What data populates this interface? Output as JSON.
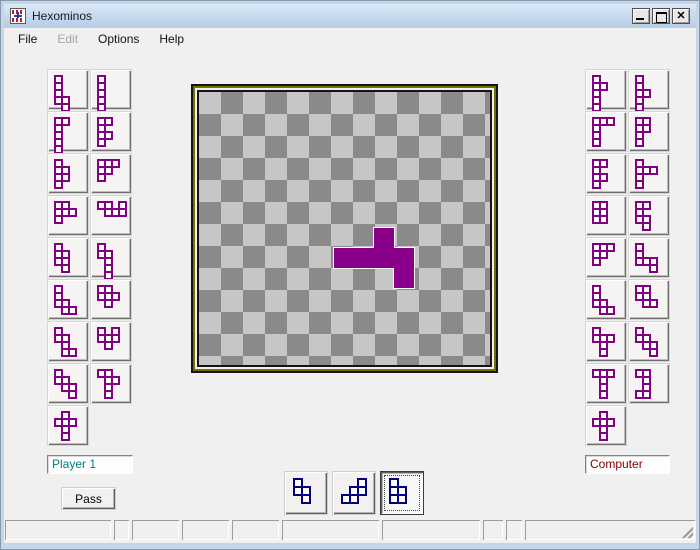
{
  "window": {
    "title": "Hexominos",
    "controls": [
      "minimize",
      "maximize",
      "close"
    ]
  },
  "menu": {
    "items": [
      {
        "label": "File",
        "enabled": true
      },
      {
        "label": "Edit",
        "enabled": false
      },
      {
        "label": "Options",
        "enabled": true
      },
      {
        "label": "Help",
        "enabled": true
      }
    ]
  },
  "colors": {
    "piece_outline_purple": "#800080",
    "placed_piece_fill": "#8B008B",
    "preview_piece_blue": "#000080",
    "player1_text": "#008080",
    "computer_text": "#800000",
    "checker_light": "#c6c6c6",
    "checker_dark": "#8a8a8a",
    "board_frame_olive": "#717100"
  },
  "left_panel": {
    "pieces": [
      [
        "X.",
        "X.",
        "X.",
        "XX",
        ".X"
      ],
      [
        "X",
        "X",
        "X",
        "X",
        "X",
        "X"
      ],
      [
        "XX",
        "X.",
        "X.",
        "X.",
        "X."
      ],
      [
        "XX",
        "X.",
        "XX",
        "X."
      ],
      [
        "X.",
        "XX",
        "XX",
        "X."
      ],
      [
        "XXX",
        "XX.",
        "X.."
      ],
      [
        "XX.",
        "XXX",
        "X.."
      ],
      [
        "XX.X",
        ".XXX"
      ],
      [
        "X.",
        "XX",
        "XX",
        ".X"
      ],
      [
        "X.",
        "XX",
        ".X",
        ".X",
        ".X"
      ],
      [
        "X..",
        "X..",
        "XX.",
        ".XX"
      ],
      [
        "XX.",
        "XXX",
        ".X."
      ],
      [
        "X..",
        "XX.",
        ".X.",
        ".XX"
      ],
      [
        "X.X",
        "XXX",
        ".X."
      ],
      [
        "X..",
        "XX.",
        ".XX",
        "..X"
      ],
      [
        "XX.",
        ".XX",
        ".X.",
        ".X."
      ],
      [
        ".X.",
        "XXX",
        ".X.",
        ".X."
      ]
    ]
  },
  "right_panel": {
    "pieces": [
      [
        "X.",
        "XX",
        "X.",
        "X.",
        "X."
      ],
      [
        "X.",
        "X.",
        "XX",
        "X.",
        "X."
      ],
      [
        "XXX",
        "X..",
        "X..",
        "X.."
      ],
      [
        "XX",
        "XX",
        "X.",
        "X."
      ],
      [
        "XX",
        "X.",
        "XX",
        "X."
      ],
      [
        "X..",
        "XXX",
        "X..",
        "X.."
      ],
      [
        "XX",
        "XX",
        "XX"
      ],
      [
        "XX",
        "X.",
        "XX",
        ".X"
      ],
      [
        "XXX",
        "XX.",
        "X.."
      ],
      [
        "X..",
        "X..",
        "XXX",
        "..X"
      ],
      [
        "X..",
        "X..",
        "XX.",
        ".XX"
      ],
      [
        "XX.",
        "XX.",
        ".XX"
      ],
      [
        "X..",
        "XXX",
        ".X.",
        ".X."
      ],
      [
        "X..",
        "XX.",
        ".XX",
        "..X"
      ],
      [
        "XXX",
        ".X.",
        ".X.",
        ".X."
      ],
      [
        "XX",
        ".X",
        ".X",
        "XX"
      ],
      [
        ".X.",
        "XXX",
        ".X.",
        ".X."
      ]
    ]
  },
  "board": {
    "placed_piece": {
      "grid": [
        "..X.",
        "XXXX",
        "...X"
      ]
    }
  },
  "bottom": {
    "previews": [
      [
        "X.",
        "XX",
        ".X"
      ],
      [
        "..X",
        ".XX",
        "XX."
      ],
      [
        "X.",
        "XX",
        "XX"
      ]
    ],
    "selected_index": 2
  },
  "player": {
    "name": "Player 1"
  },
  "computer": {
    "name": "Computer"
  },
  "pass_button": {
    "label": "Pass"
  },
  "status_bar": {
    "panels": [
      "",
      "",
      "",
      "",
      "",
      "",
      "",
      "",
      "",
      ""
    ]
  }
}
